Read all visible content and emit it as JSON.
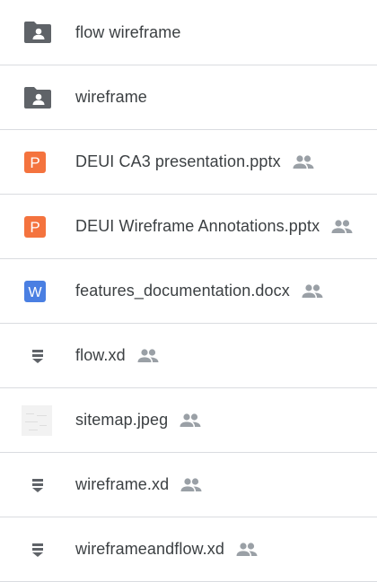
{
  "files": [
    {
      "name": "flow wireframe",
      "type": "shared-folder",
      "shared": false
    },
    {
      "name": "wireframe",
      "type": "shared-folder",
      "shared": false
    },
    {
      "name": "DEUI CA3 presentation.pptx",
      "type": "slides",
      "shared": true
    },
    {
      "name": "DEUI Wireframe Annotations.pptx",
      "type": "slides",
      "shared": true
    },
    {
      "name": "features_documentation.docx",
      "type": "docs",
      "shared": true
    },
    {
      "name": "flow.xd",
      "type": "generic-file",
      "shared": true
    },
    {
      "name": "sitemap.jpeg",
      "type": "image",
      "shared": true
    },
    {
      "name": "wireframe.xd",
      "type": "generic-file",
      "shared": true
    },
    {
      "name": "wireframeandflow.xd",
      "type": "generic-file",
      "shared": true
    }
  ],
  "icon_letters": {
    "slides": "P",
    "docs": "W"
  },
  "colors": {
    "folder": "#5f6368",
    "slides": "#f4733e",
    "docs": "#4a7fe2",
    "shared_icon": "#9aa0a6",
    "generic_file": "#5f6368"
  }
}
